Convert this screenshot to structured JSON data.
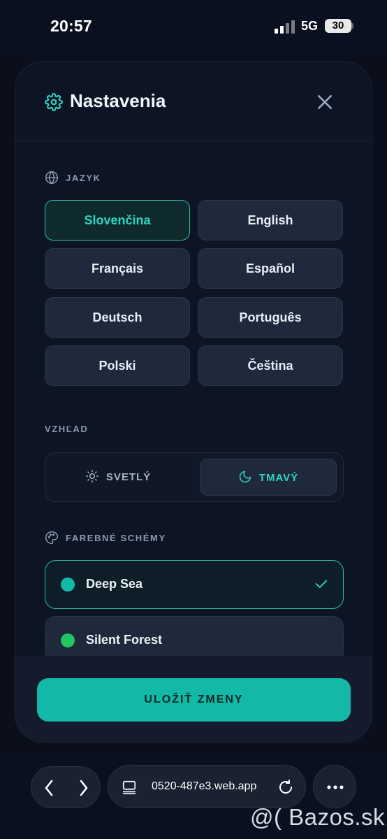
{
  "status_bar": {
    "time": "20:57",
    "network": "5G",
    "battery": "30"
  },
  "modal": {
    "title": "Nastavenia",
    "title_icon": "gear-icon",
    "close_icon": "close-icon",
    "language": {
      "label": "JAZYK",
      "icon": "globe-icon",
      "options": [
        "Slovenčina",
        "English",
        "Français",
        "Español",
        "Deutsch",
        "Português",
        "Polski",
        "Čeština"
      ],
      "selected": "Slovenčina"
    },
    "appearance": {
      "label": "VZHĽAD",
      "light_label": "SVETLÝ",
      "dark_label": "TMAVÝ",
      "selected": "TMAVÝ"
    },
    "color_schemes": {
      "label": "FAREBNÉ SCHÉMY",
      "icon": "palette-icon",
      "items": [
        {
          "name": "Deep Sea",
          "color": "#14b8a6",
          "selected": true
        },
        {
          "name": "Silent Forest",
          "color": "#22c55e",
          "selected": false
        }
      ]
    },
    "save_label": "ULOŽIŤ ZMENY"
  },
  "browser": {
    "url": "0520-487e3.web.app"
  },
  "watermark": "@( Bazos.sk",
  "colors": {
    "accent": "#14b8a6",
    "accent_text": "#2dd4bf",
    "modal_bg": "#0d1424",
    "card_bg": "#1e293b"
  }
}
